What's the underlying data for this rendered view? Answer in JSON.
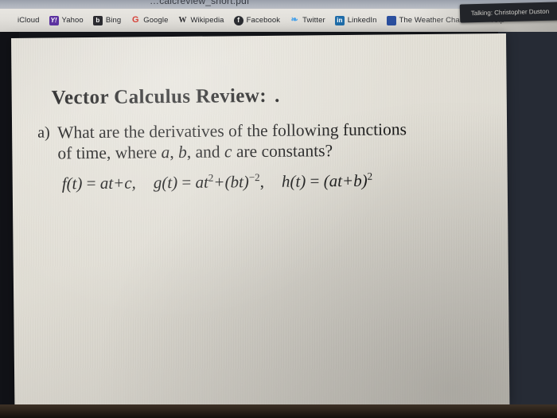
{
  "window": {
    "title_fragment": "…calcreview_short.pdf"
  },
  "bookmarks_bar": {
    "items": [
      {
        "label": "iCloud",
        "icon": "icloud-icon",
        "glyph": ""
      },
      {
        "label": "Yahoo",
        "icon": "yahoo-icon",
        "glyph": "Y!"
      },
      {
        "label": "Bing",
        "icon": "bing-icon",
        "glyph": "b"
      },
      {
        "label": "Google",
        "icon": "google-icon",
        "glyph": "G"
      },
      {
        "label": "Wikipedia",
        "icon": "wikipedia-icon",
        "glyph": "W"
      },
      {
        "label": "Facebook",
        "icon": "facebook-icon",
        "glyph": "f"
      },
      {
        "label": "Twitter",
        "icon": "twitter-icon",
        "glyph": "❧"
      },
      {
        "label": "LinkedIn",
        "icon": "linkedin-icon",
        "glyph": "in"
      },
      {
        "label": "The Weather Cha…",
        "icon": "weather-icon",
        "glyph": ""
      },
      {
        "label": "Yelp",
        "icon": "yelp-icon",
        "glyph": "⟲"
      }
    ]
  },
  "notification": {
    "text": "Talking: Christopher Duston"
  },
  "document": {
    "title": "Vector Calculus Review:",
    "title_trailing_mark": ".",
    "question_marker": "a)",
    "question_line_1": "What are the derivatives of the following functions",
    "question_line_2_a": "of time, where ",
    "question_line_2_var_a": "a",
    "question_line_2_b": ", ",
    "question_line_2_var_b": "b",
    "question_line_2_c": ", and ",
    "question_line_2_var_c": "c",
    "question_line_2_d": " are constants?",
    "equations": [
      {
        "lhs": "f(t)",
        "eq": "=",
        "rhs_plain": "at+c,"
      },
      {
        "lhs": "g(t)",
        "eq": "=",
        "rhs_base": "at",
        "rhs_exp1": "2",
        "rhs_mid": "+(bt)",
        "rhs_exp2": "−2",
        "rhs_tail": ","
      },
      {
        "lhs": "h(t)",
        "eq": "=",
        "rhs_base": "(at+b)",
        "rhs_exp": "2"
      }
    ]
  },
  "colors": {
    "page_bg": "#e0ddd4",
    "ink": "#131313",
    "bookmark_bar_bg": "#e2e0db",
    "bezel_dark": "#111217",
    "bezel_blue": "#2a3040",
    "tooltip_bg": "#222429"
  }
}
